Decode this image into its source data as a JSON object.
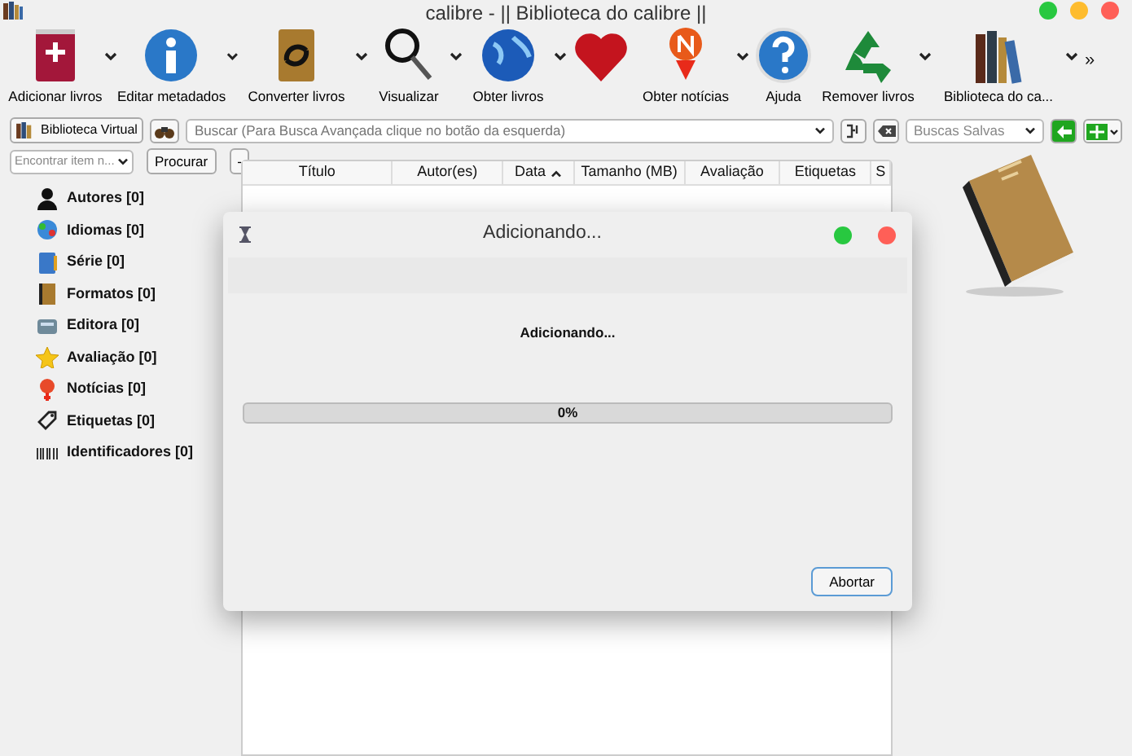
{
  "window": {
    "title": "calibre - || Biblioteca do calibre ||",
    "controls": [
      {
        "color": "#28c840"
      },
      {
        "color": "#febc2e"
      },
      {
        "color": "#ff5f57"
      }
    ]
  },
  "toolbar": {
    "items": [
      {
        "label": "Adicionar livros",
        "dropdown": true
      },
      {
        "label": "Editar metadados",
        "dropdown": true
      },
      {
        "label": "Converter livros",
        "dropdown": true
      },
      {
        "label": "Visualizar",
        "dropdown": true
      },
      {
        "label": "Obter livros",
        "dropdown": true
      },
      {
        "dropdown": false
      },
      {
        "label": "Obter notícias",
        "dropdown": true
      },
      {
        "label": "Ajuda",
        "dropdown": false
      },
      {
        "label": "Remover livros",
        "dropdown": true
      },
      {
        "label": "Biblioteca do ca...",
        "dropdown": true
      }
    ],
    "overflow": "»"
  },
  "search_bar": {
    "virtual_library": "Biblioteca Virtual",
    "placeholder": "Buscar (Para Busca Avançada clique no botão da esquerda)",
    "saved_searches": "Buscas Salvas"
  },
  "tag_browser": {
    "find_placeholder": "Encontrar item n...",
    "find_button": "Procurar",
    "collapse_button": "-",
    "items": [
      {
        "label": "Autores [0]"
      },
      {
        "label": "Idiomas [0]"
      },
      {
        "label": "Série [0]"
      },
      {
        "label": "Formatos [0]"
      },
      {
        "label": "Editora [0]"
      },
      {
        "label": "Avaliação [0]"
      },
      {
        "label": "Notícias [0]"
      },
      {
        "label": "Etiquetas [0]"
      },
      {
        "label": "Identificadores [0]"
      }
    ]
  },
  "table": {
    "columns": [
      {
        "label": "Título",
        "sorted": false
      },
      {
        "label": "Autor(es)",
        "sorted": false
      },
      {
        "label": "Data",
        "sorted": true
      },
      {
        "label": "Tamanho (MB)",
        "sorted": false
      },
      {
        "label": "Avaliação",
        "sorted": false
      },
      {
        "label": "Etiquetas",
        "sorted": false
      },
      {
        "label": "S",
        "sorted": false
      }
    ]
  },
  "dialog": {
    "title": "Adicionando...",
    "controls": [
      {
        "color": "#28c840"
      },
      {
        "color": "#ff5f57"
      }
    ],
    "message": "Adicionando...",
    "progress": {
      "level": 0,
      "text": "0%"
    },
    "button": "Abortar"
  }
}
